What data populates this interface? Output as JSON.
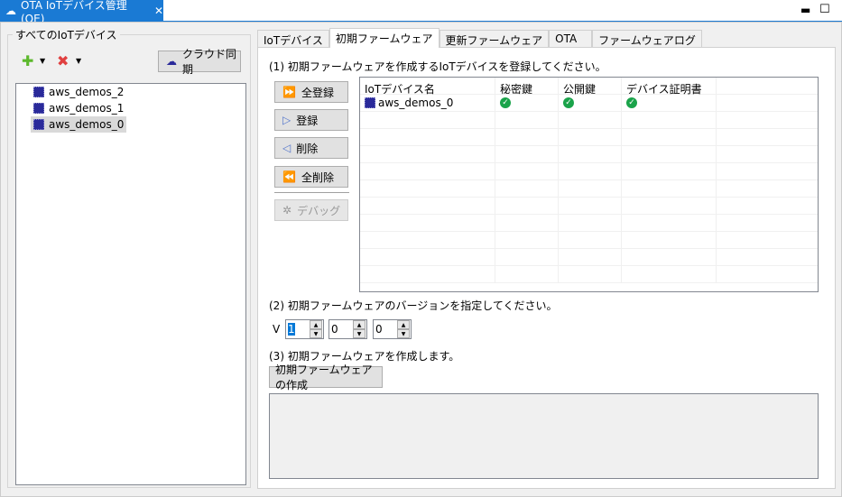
{
  "view": {
    "title": "OTA IoTデバイス管理 (QE)",
    "close": "✕"
  },
  "left": {
    "group_label": "すべてのIoTデバイス",
    "sync_label": "クラウド同期",
    "devices": [
      "aws_demos_2",
      "aws_demos_1",
      "aws_demos_0"
    ]
  },
  "tabs": [
    "IoTデバイス",
    "初期ファームウェア",
    "更新ファームウェア",
    "OTA",
    "ファームウェアログ"
  ],
  "step1": "(1) 初期ファームウェアを作成するIoTデバイスを登録してください。",
  "buttons": {
    "add_all": "全登録",
    "add": "登録",
    "remove": "削除",
    "remove_all": "全削除",
    "debug": "デバッグ"
  },
  "table": {
    "columns": [
      "IoTデバイス名",
      "秘密鍵",
      "公開鍵",
      "デバイス証明書"
    ],
    "rows": [
      {
        "name": "aws_demos_0",
        "private_key": "ok",
        "public_key": "ok",
        "cert": "ok"
      }
    ]
  },
  "step2": "(2) 初期ファームウェアのバージョンを指定してください。",
  "version": {
    "prefix": "V",
    "major": "1",
    "minor": "0",
    "patch": "0"
  },
  "step3": "(3) 初期ファームウェアを作成します。",
  "create_label": "初期ファームウェアの作成",
  "colors": {
    "accent": "#1a7ad4",
    "check": "#1aa34a"
  }
}
